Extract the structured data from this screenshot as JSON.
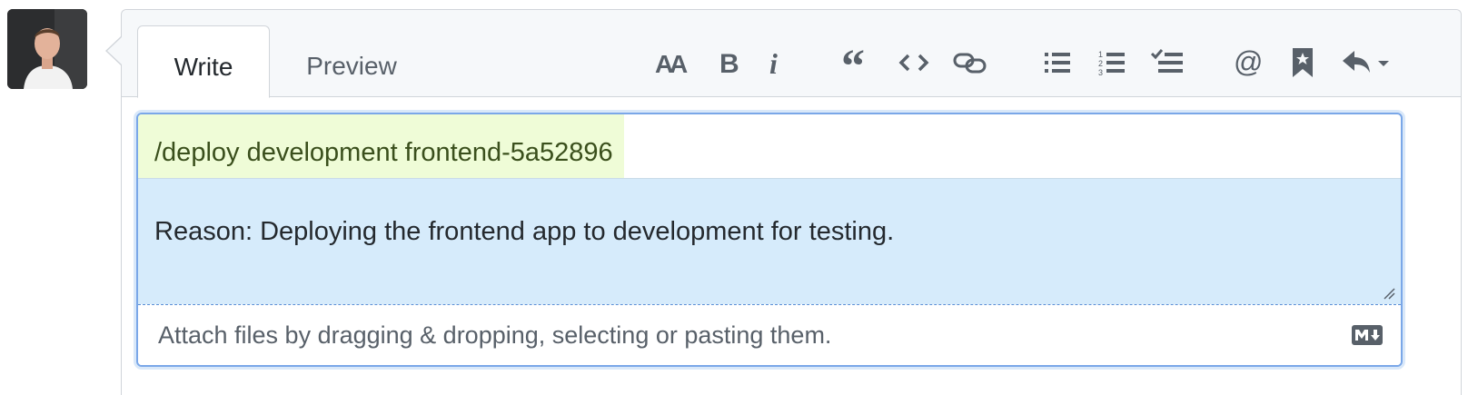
{
  "tabs": [
    {
      "label": "Write",
      "active": true
    },
    {
      "label": "Preview",
      "active": false
    }
  ],
  "toolbar": {
    "icons": [
      "text-size-icon",
      "bold-icon",
      "italic-icon",
      "quote-icon",
      "code-icon",
      "link-icon",
      "unordered-list-icon",
      "ordered-list-icon",
      "task-list-icon",
      "mention-icon",
      "saved-reply-icon",
      "reply-icon"
    ]
  },
  "editor": {
    "line1": "/deploy development frontend-5a52896",
    "line2": "Reason: Deploying the frontend app to development for testing."
  },
  "attach": {
    "text": "Attach files by dragging & dropping, selecting or pasting them."
  },
  "colors": {
    "command_highlight": "#effcd7",
    "selection_highlight": "#d6ebfb",
    "focus_border": "#7aa7e8"
  }
}
